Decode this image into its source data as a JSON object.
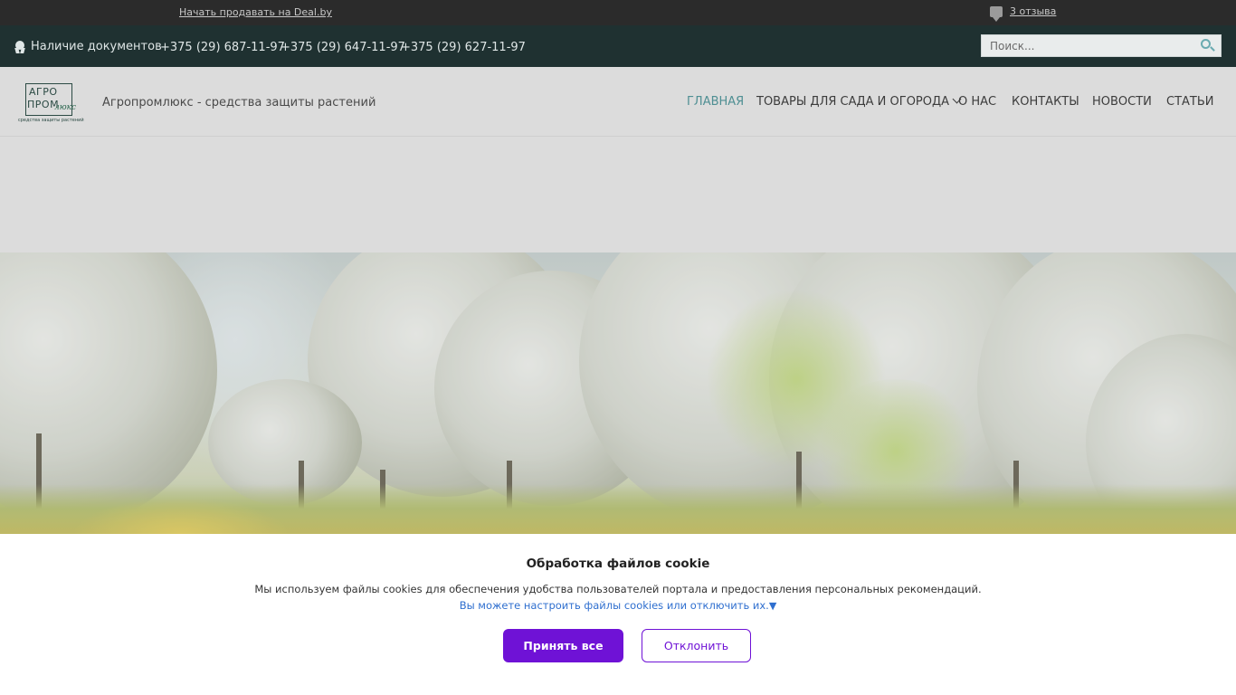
{
  "topbar": {
    "sell_link": "Начать продавать на Deal.by",
    "reviews_link": "3 отзыва",
    "reviews_icon": "speech-bubble-icon"
  },
  "contacts": {
    "documents": "Наличие документов",
    "documents_icon": "medal-icon",
    "phones": [
      "+375 (29) 687-11-97",
      "+375 (29) 647-11-97",
      "+375 (29) 627-11-97"
    ],
    "search_placeholder": "Поиск...",
    "search_icon": "search-icon"
  },
  "header": {
    "logo": {
      "line1": "АГРО",
      "line2": "ПРОМ",
      "script": "люкс",
      "tagline": "средства защиты растений"
    },
    "site_title": "Агропромлюкс - средства защиты растений",
    "nav": [
      {
        "label": "ГЛАВНАЯ",
        "active": true
      },
      {
        "label": "ТОВАРЫ ДЛЯ САДА И ОГОРОДА",
        "has_dropdown": true
      },
      {
        "label": "О НАС"
      },
      {
        "label": "КОНТАКТЫ"
      },
      {
        "label": "НОВОСТИ"
      },
      {
        "label": "СТАТЬИ"
      }
    ],
    "accent_color": "#4f8f93"
  },
  "cookie": {
    "title": "Обработка файлов cookie",
    "text": "Мы используем файлы cookies для обеспечения удобства пользователей портала и предоставления персональных рекомендаций.",
    "settings_link": "Вы можете настроить файлы cookies или отключить их.",
    "settings_arrow": "▼",
    "accept_label": "Принять все",
    "decline_label": "Отклонить",
    "accent_color": "#6f12d6"
  }
}
